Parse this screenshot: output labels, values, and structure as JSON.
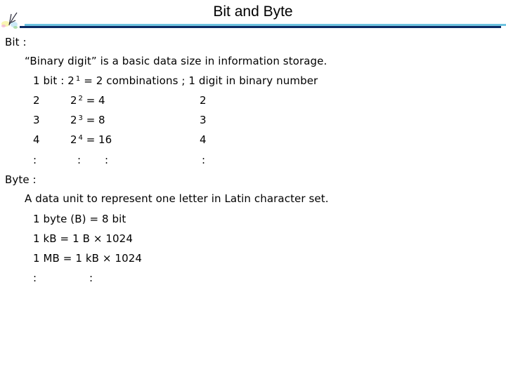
{
  "header": {
    "title": "Bit and Byte",
    "logo_icon": "signature-logo-icon",
    "rule_colors": {
      "light": "#6ec3e0",
      "dark": "#0b2a63"
    }
  },
  "bit": {
    "heading": "Bit :",
    "definition": "“Binary digit” is a basic data size in information storage.",
    "first_row": {
      "prefix": "1 bit : 2",
      "exp": "1",
      "suffix": " = 2 combinations ; 1 digit in binary number"
    },
    "table": [
      {
        "n": "2",
        "base": "2",
        "exp": "2",
        "result": "= 4",
        "digits": "2"
      },
      {
        "n": "3",
        "base": "2",
        "exp": "3",
        "result": "= 8",
        "digits": "3"
      },
      {
        "n": "4",
        "base": "2",
        "exp": "4",
        "result": "= 16",
        "digits": "4"
      }
    ],
    "ellipsis": ":"
  },
  "byte": {
    "heading": "Byte :",
    "definition": "A data unit to represent one letter in Latin character set.",
    "lines": [
      "1 byte (B) = 8 bit",
      "1 kB = 1 B × 1024",
      "1 MB = 1 kB × 1024"
    ],
    "ellipsis": ":"
  }
}
